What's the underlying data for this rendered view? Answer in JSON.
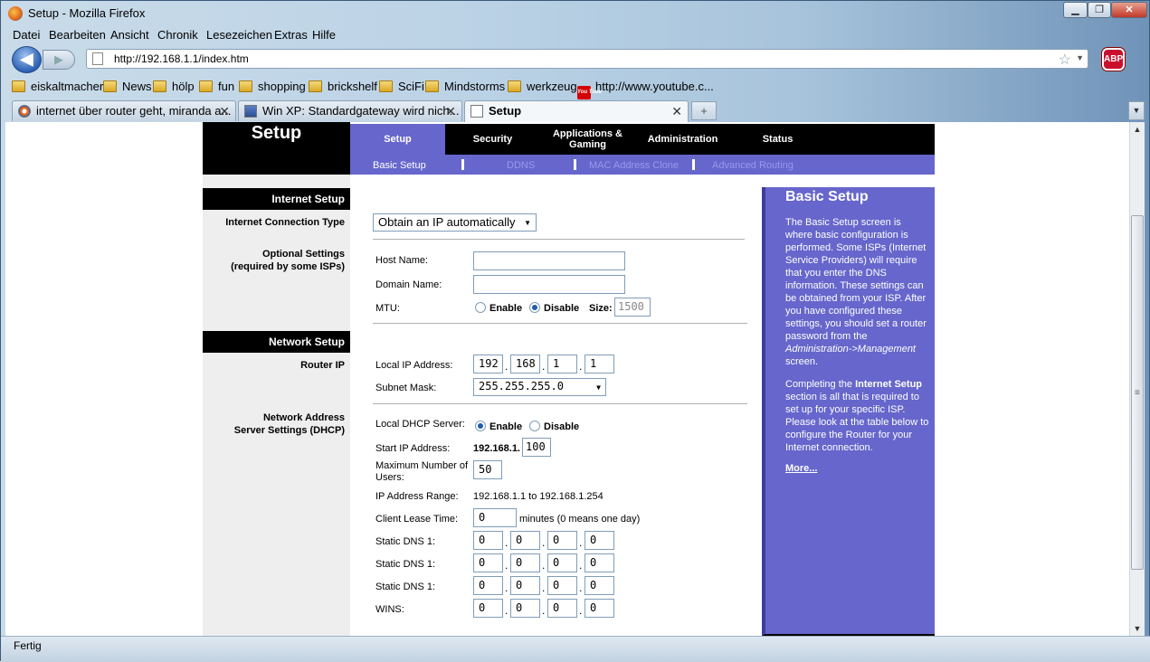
{
  "window": {
    "title": "Setup - Mozilla Firefox",
    "min": "▁",
    "max": "❐",
    "close": "✕"
  },
  "menu": [
    "Datei",
    "Bearbeiten",
    "Ansicht",
    "Chronik",
    "Lesezeichen",
    "Extras",
    "Hilfe"
  ],
  "nav": {
    "back": "◀",
    "forward": "▶",
    "url": "http://192.168.1.1/index.htm",
    "star": "☆",
    "dd": "▼",
    "abp": "ABP"
  },
  "bookmarks": [
    "eiskaltmacher",
    "News",
    "hölp",
    "fun",
    "shopping",
    "brickshelf",
    "SciFi",
    "Mindstorms",
    "werkzeug",
    "http://www.youtube.c..."
  ],
  "youtube_icon_text": "You Tube",
  "tabs": [
    {
      "label": "internet über router geht, miranda a...",
      "close": "✕"
    },
    {
      "label": "Win XP: Standardgateway wird nich...",
      "close": "✕"
    },
    {
      "label": "Setup",
      "close": "✕"
    }
  ],
  "tab_new": "+",
  "tab_list": "▼",
  "status": {
    "text": "Fertig"
  },
  "scroll": {
    "up": "▲",
    "down": "▼",
    "grip": "≡"
  },
  "router": {
    "logo": "Setup",
    "topnav": {
      "setup": "Setup",
      "security": "Security",
      "apps": "Applications & Gaming",
      "admin": "Administration",
      "status": "Status"
    },
    "subnav": {
      "basic": "Basic Setup",
      "ddns": "DDNS",
      "mac": "MAC Address Clone",
      "routing": "Advanced Routing"
    },
    "sections": {
      "internet": "Internet Setup",
      "network": "Network Setup"
    },
    "labels": {
      "conn_type": "Internet Connection Type",
      "optional": "Optional Settings",
      "optional2": "(required by some ISPs)",
      "router_ip": "Router IP",
      "dhcp1": "Network Address",
      "dhcp2": "Server Settings (DHCP)"
    },
    "conn_type_value": "Obtain an IP automatically",
    "host_name": {
      "label": "Host Name:",
      "value": ""
    },
    "domain_name": {
      "label": "Domain Name:",
      "value": ""
    },
    "mtu": {
      "label": "MTU:",
      "enable": "Enable",
      "disable": "Disable",
      "size_label": "Size:",
      "size": "1500",
      "selected": "Disable"
    },
    "local_ip": {
      "label": "Local IP Address:",
      "o1": "192",
      "o2": "168",
      "o3": "1",
      "o4": "1"
    },
    "subnet": {
      "label": "Subnet Mask:",
      "value": "255.255.255.0"
    },
    "dhcp_server": {
      "label": "Local DHCP Server:",
      "enable": "Enable",
      "disable": "Disable",
      "selected": "Enable"
    },
    "start_ip": {
      "label": "Start IP Address:",
      "prefix": "192.168.1.",
      "value": "100"
    },
    "max_users": {
      "label1": "Maximum Number of",
      "label2": "Users:",
      "value": "50"
    },
    "ip_range": {
      "label": "IP  Address  Range:",
      "value": "192.168.1.1 to 192.168.1.254"
    },
    "lease": {
      "label": "Client Lease Time:",
      "value": "0",
      "suffix": "minutes (0 means one day)"
    },
    "dns1": {
      "label": "Static DNS 1:",
      "o1": "0",
      "o2": "0",
      "o3": "0",
      "o4": "0"
    },
    "dns2": {
      "label": "Static DNS 1:",
      "o1": "0",
      "o2": "0",
      "o3": "0",
      "o4": "0"
    },
    "dns3": {
      "label": "Static DNS 1:",
      "o1": "0",
      "o2": "0",
      "o3": "0",
      "o4": "0"
    },
    "wins": {
      "label": "WINS:",
      "o1": "0",
      "o2": "0",
      "o3": "0",
      "o4": "0"
    },
    "dot": ".",
    "help": {
      "title": "Basic Setup",
      "p1": "The Basic Setup screen is where basic configuration is performed. Some ISPs (Internet Service Providers) will require that you enter the DNS information. These settings can be obtained from your ISP. After you have configured these settings, you should set a router password from the",
      "p1_em": "Administration->Management",
      "p1_end": "screen.",
      "p2_a": "Completing the",
      "p2_b": "Internet Setup",
      "p2_c": "section is all that is required to set up for your specific ISP. Please look at the table below to configure the Router for your Internet connection.",
      "more": "More..."
    }
  }
}
